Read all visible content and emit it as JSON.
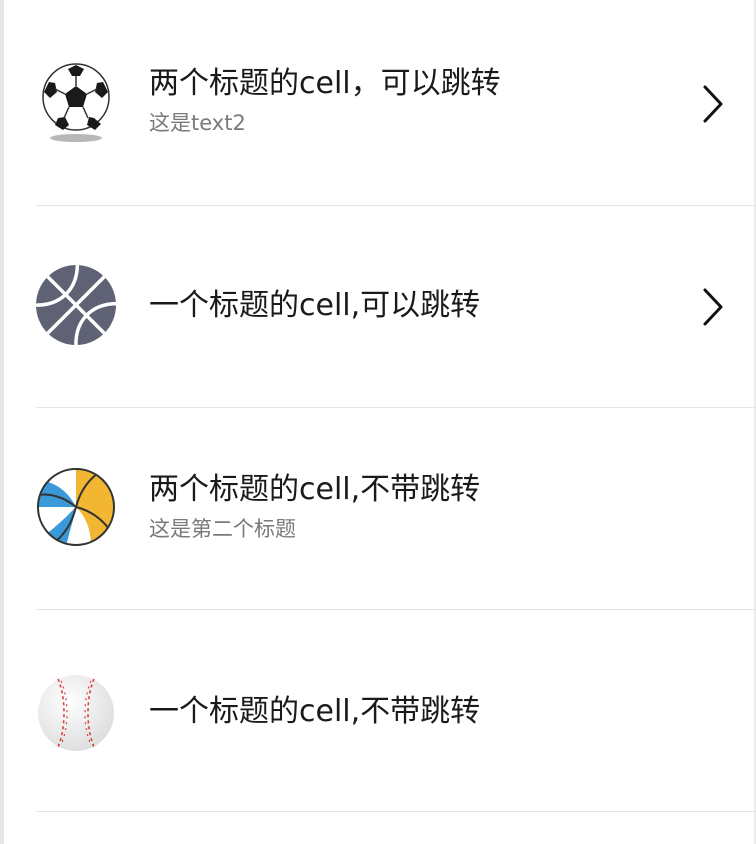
{
  "cells": [
    {
      "title": "两个标题的cell，可以跳转",
      "subtitle": "这是text2",
      "icon": "soccer-ball-icon",
      "navigable": true
    },
    {
      "title": "一个标题的cell,可以跳转",
      "icon": "basketball-icon",
      "navigable": true
    },
    {
      "title": "两个标题的cell,不带跳转",
      "subtitle": "这是第二个标题",
      "icon": "volleyball-icon",
      "navigable": false
    },
    {
      "title": "一个标题的cell,不带跳转",
      "icon": "baseball-icon",
      "navigable": false
    }
  ],
  "colors": {
    "title": "#1a1a1a",
    "subtitle": "#7a7a7a",
    "divider": "#e5e5e5",
    "basketball": "#5f6174",
    "volleyball_yellow": "#f2b632",
    "volleyball_blue": "#3a9ad9",
    "baseball_stitch": "#d9413b"
  }
}
